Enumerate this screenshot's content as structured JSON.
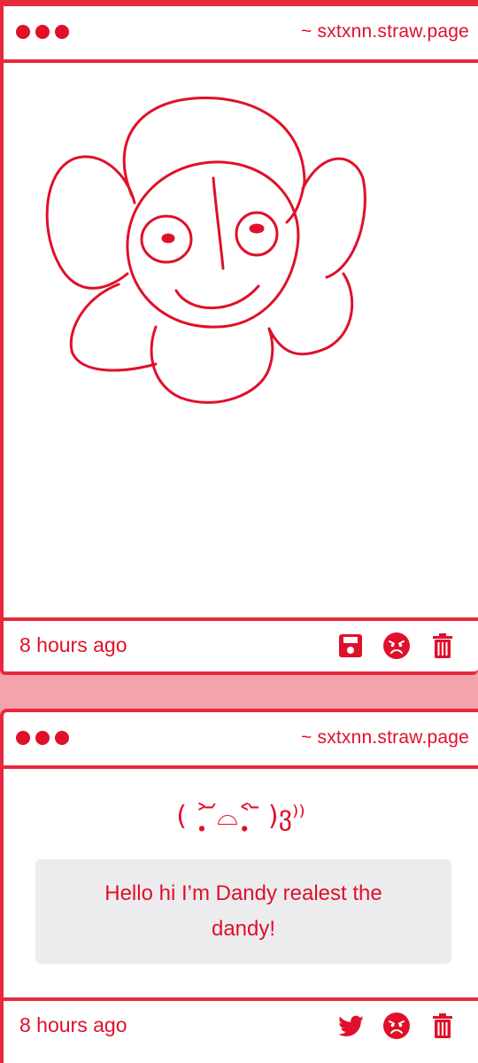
{
  "posts": [
    {
      "site": "~ sxtxnn.straw.page",
      "time": "8 hours ago",
      "actions": [
        "save-icon",
        "angry-face-icon",
        "trash-icon"
      ]
    },
    {
      "site": "~ sxtxnn.straw.page",
      "kaomoji": "( ˃̣̣̥ ᷄⌓˂̣̣̥ ᷅ )ვ⁾⁾",
      "message": "Hello hi I’m Dandy realest the dandy!",
      "time": "8 hours ago",
      "actions": [
        "twitter-icon",
        "angry-face-icon",
        "trash-icon"
      ]
    }
  ],
  "colors": {
    "accent": "#e0102a",
    "border": "#e8283d",
    "background": "#f4a3ac",
    "message_bg": "#ececee"
  }
}
